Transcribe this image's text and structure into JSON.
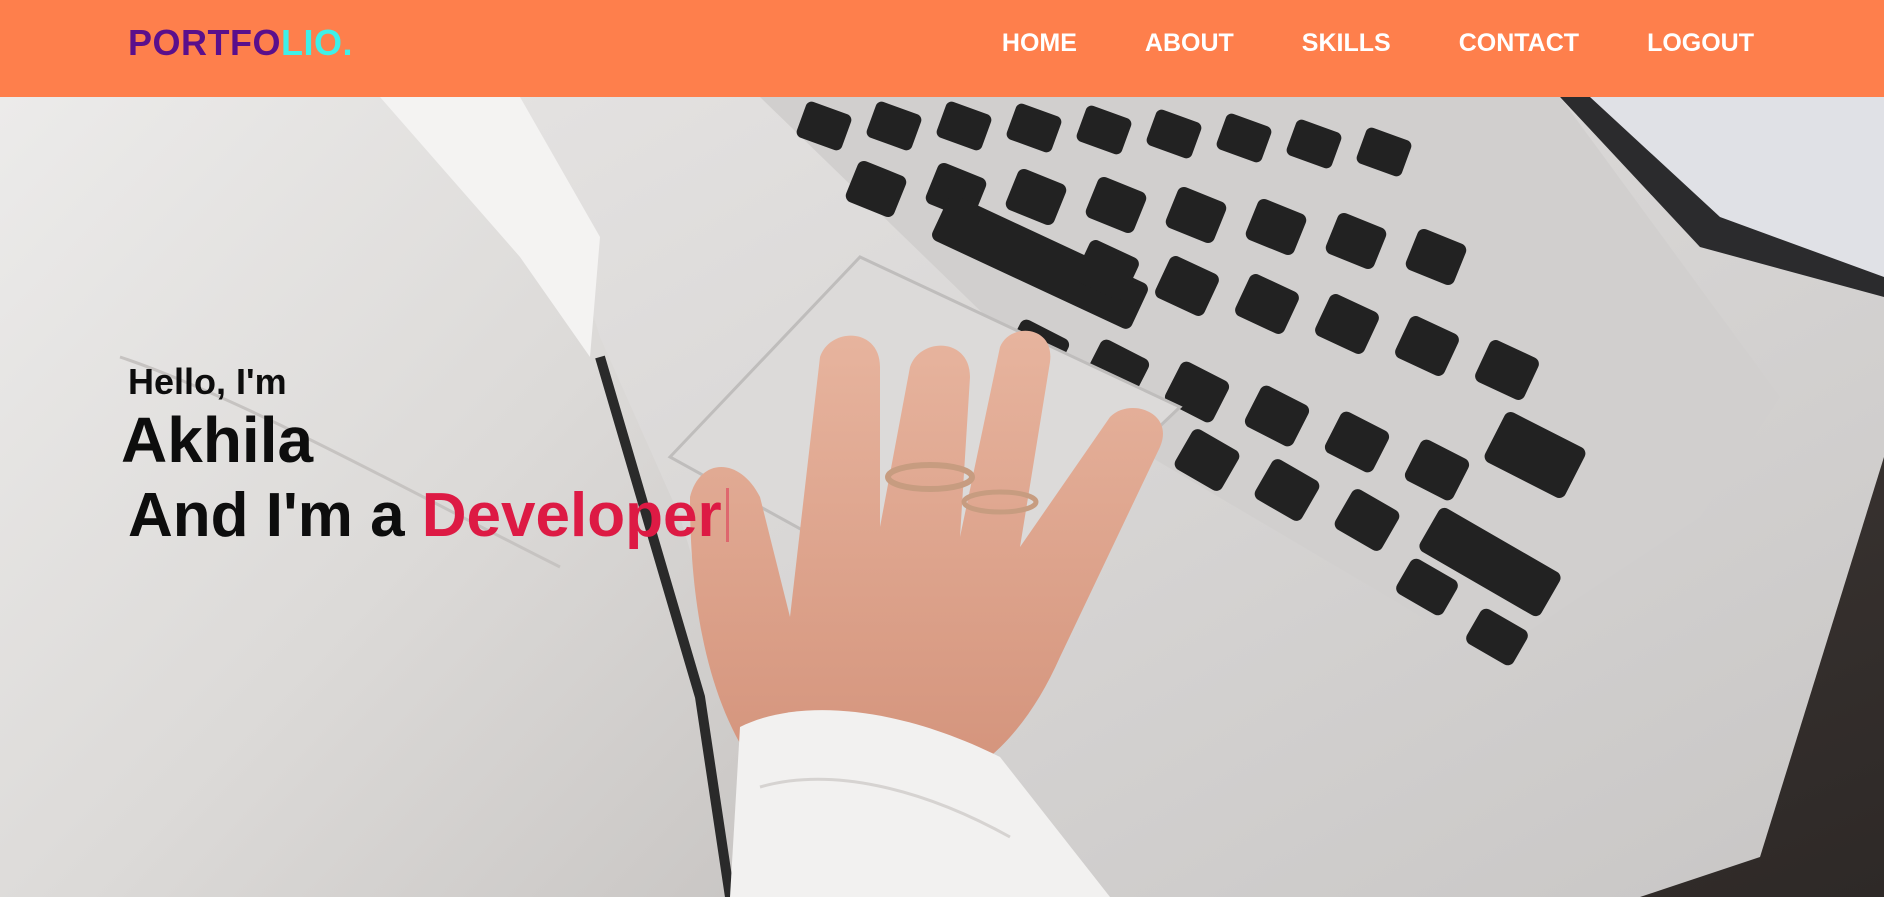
{
  "brand": {
    "logo_part_a": "PORTFO",
    "logo_part_b": "LIO.",
    "logo_color_a": "#5a0f8c",
    "logo_color_b": "#3ef0e8"
  },
  "nav": {
    "items": [
      {
        "label": "HOME"
      },
      {
        "label": "ABOUT"
      },
      {
        "label": "SKILLS"
      },
      {
        "label": "CONTACT"
      },
      {
        "label": "LOGOUT"
      }
    ],
    "background": "#fe7f4c"
  },
  "hero": {
    "greeting": "Hello, I'm",
    "name": "Akhila",
    "role_prefix": "And I'm a ",
    "role": "Developer",
    "role_color": "#dd1a44",
    "background_image": "laptop-keyboard-hand-photo"
  }
}
